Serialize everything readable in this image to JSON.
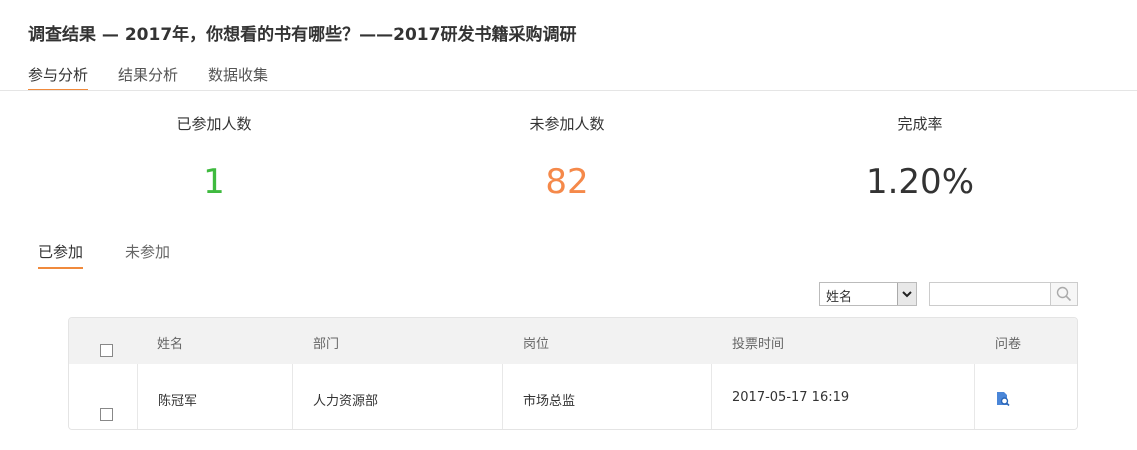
{
  "page": {
    "title": "调查结果 — 2017年，你想看的书有哪些？——2017研发书籍采购调研"
  },
  "top_tabs": [
    {
      "label": "参与分析",
      "active": true
    },
    {
      "label": "结果分析",
      "active": false
    },
    {
      "label": "数据收集",
      "active": false
    }
  ],
  "stats": {
    "participated": {
      "label": "已参加人数",
      "value": "1"
    },
    "not_participated": {
      "label": "未参加人数",
      "value": "82"
    },
    "completion": {
      "label": "完成率",
      "value": "1.20%"
    }
  },
  "colors": {
    "accent": "#f08a3c",
    "participated": "#3fba3f",
    "not_participated": "#f5894a"
  },
  "sub_tabs": [
    {
      "label": "已参加",
      "active": true
    },
    {
      "label": "未参加",
      "active": false
    }
  ],
  "filter": {
    "field_selected": "姓名",
    "search_value": "",
    "search_icon": "magnifier-icon"
  },
  "table": {
    "columns": [
      "姓名",
      "部门",
      "岗位",
      "投票时间",
      "问卷"
    ],
    "rows": [
      {
        "checked": false,
        "name": "陈冠军",
        "department": "人力资源部",
        "position": "市场总监",
        "vote_time": "2017-05-17 16:19",
        "survey_icon": "document-search-icon"
      }
    ]
  }
}
